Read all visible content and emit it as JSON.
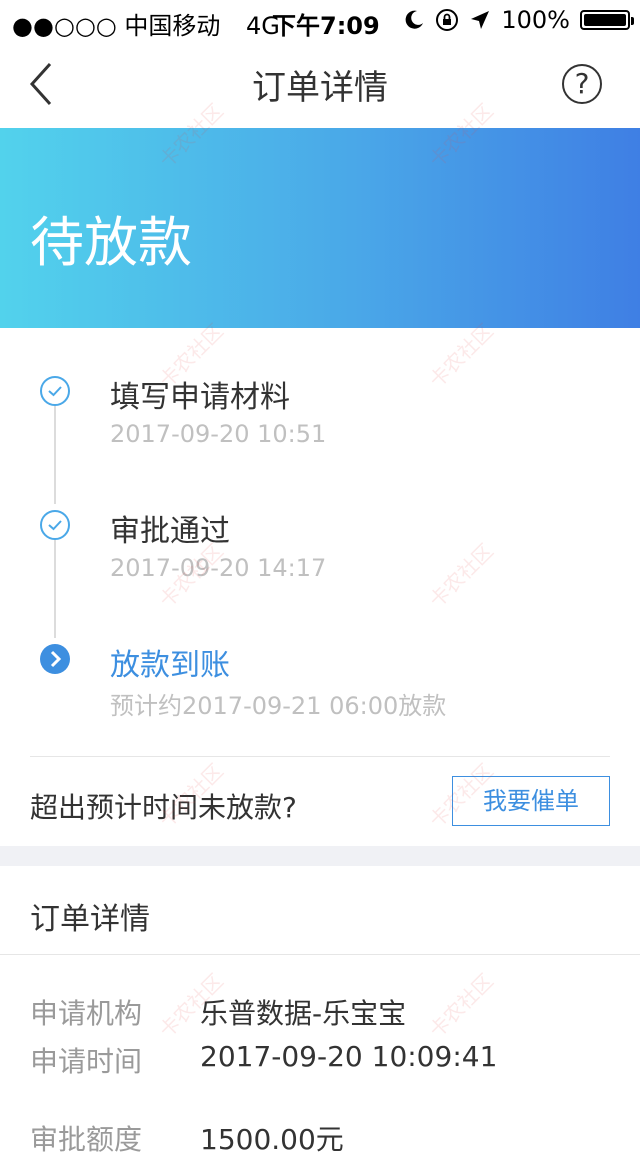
{
  "status_bar": {
    "carrier": "●●○○○ 中国移动",
    "network": "4G",
    "time": "下午7:09",
    "battery": "100%"
  },
  "nav": {
    "title": "订单详情",
    "help_glyph": "?"
  },
  "banner": {
    "title": "待放款"
  },
  "timeline": [
    {
      "title": "填写申请材料",
      "time": "2017-09-20 10:51",
      "state": "done"
    },
    {
      "title": "审批通过",
      "time": "2017-09-20 14:17",
      "state": "done"
    },
    {
      "title": "放款到账",
      "time": "预计约2017-09-21 06:00放款",
      "state": "active"
    }
  ],
  "urge": {
    "text": "超出预计时间未放款?",
    "button_label": "我要催单"
  },
  "details": {
    "section_title": "订单详情",
    "rows": [
      {
        "label": "申请机构",
        "value": "乐普数据-乐宝宝"
      },
      {
        "label": "申请时间",
        "value": "2017-09-20 10:09:41"
      },
      {
        "label": "审批额度",
        "value": "1500.00元"
      }
    ]
  },
  "watermark": {
    "text": "卡农社区"
  },
  "colors": {
    "accent": "#3d8fe0",
    "banner_start": "#52d2ec",
    "banner_end": "#3f7fe4"
  }
}
